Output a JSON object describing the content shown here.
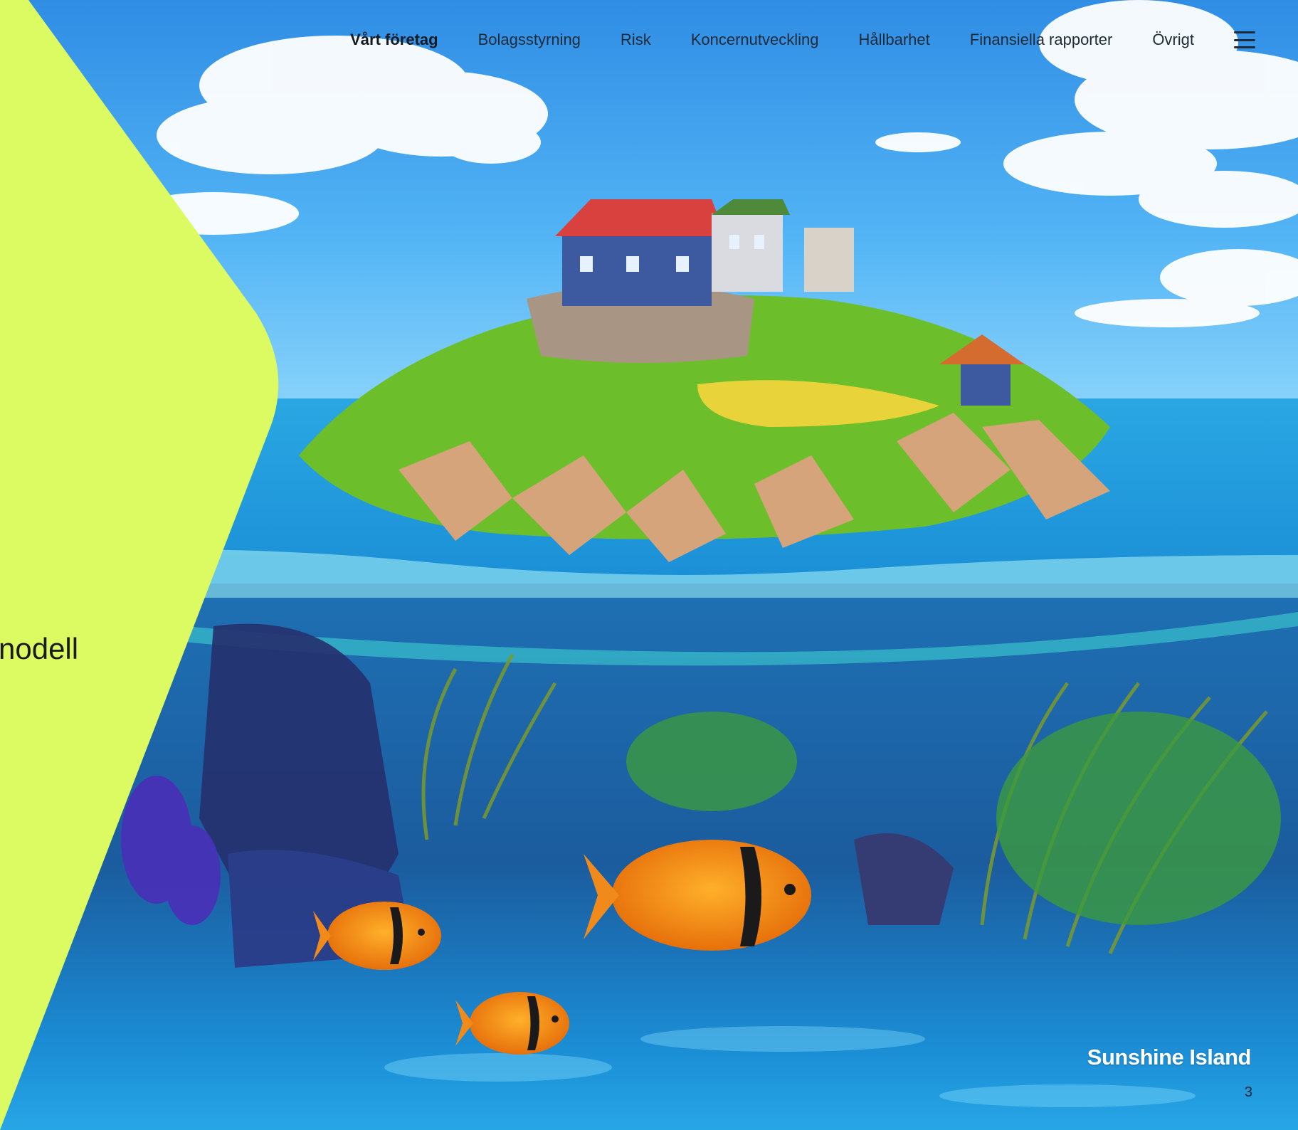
{
  "nav": {
    "items": [
      {
        "label": "Vårt företag",
        "active": true
      },
      {
        "label": "Bolagsstyrning"
      },
      {
        "label": "Risk"
      },
      {
        "label": "Koncernutveckling"
      },
      {
        "label": "Hållbarhet"
      },
      {
        "label": "Finansiella rapporter"
      },
      {
        "label": "Övrigt"
      }
    ],
    "menu_icon": "hamburger-menu-icon"
  },
  "panel": {
    "partial_text": "nodell",
    "color": "#dcfb63"
  },
  "hero": {
    "caption": "Sunshine Island",
    "page_number": "3"
  }
}
